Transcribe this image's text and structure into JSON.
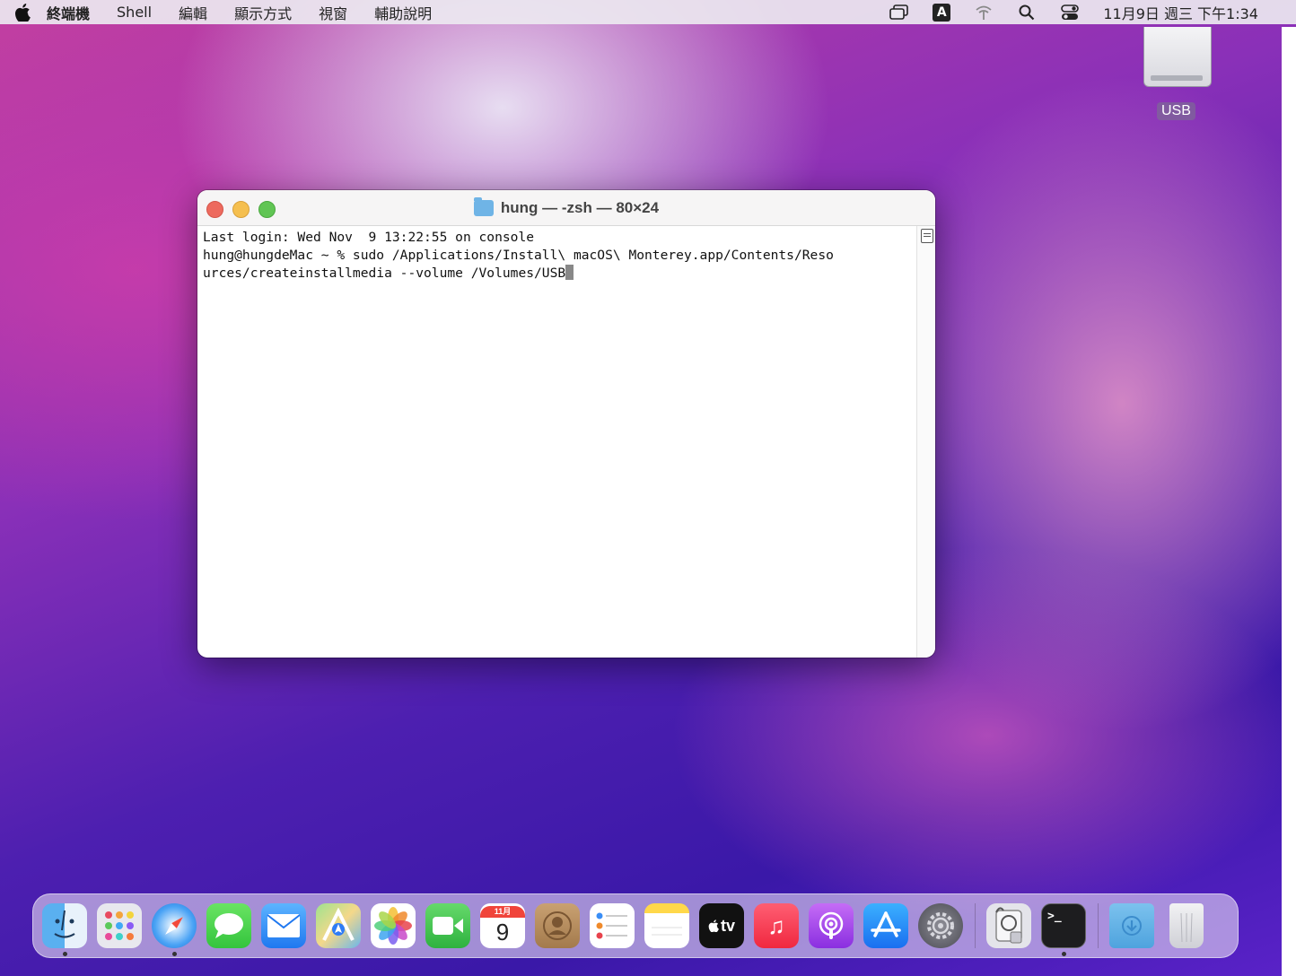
{
  "menubar": {
    "app_name": "終端機",
    "items": [
      "Shell",
      "編輯",
      "顯示方式",
      "視窗",
      "輔助說明"
    ],
    "input_method": "A",
    "clock": "11月9日 週三 下午1:34"
  },
  "desktop": {
    "usb_label": "USB"
  },
  "terminal": {
    "title": "hung — -zsh — 80×24",
    "lines": [
      "Last login: Wed Nov  9 13:22:55 on console",
      "hung@hungdeMac ~ % sudo /Applications/Install\\ macOS\\ Monterey.app/Contents/Reso",
      "urces/createinstallmedia --volume /Volumes/USB"
    ]
  },
  "dock": {
    "calendar_month": "11月",
    "calendar_day": "9",
    "tv_label": "tv"
  }
}
